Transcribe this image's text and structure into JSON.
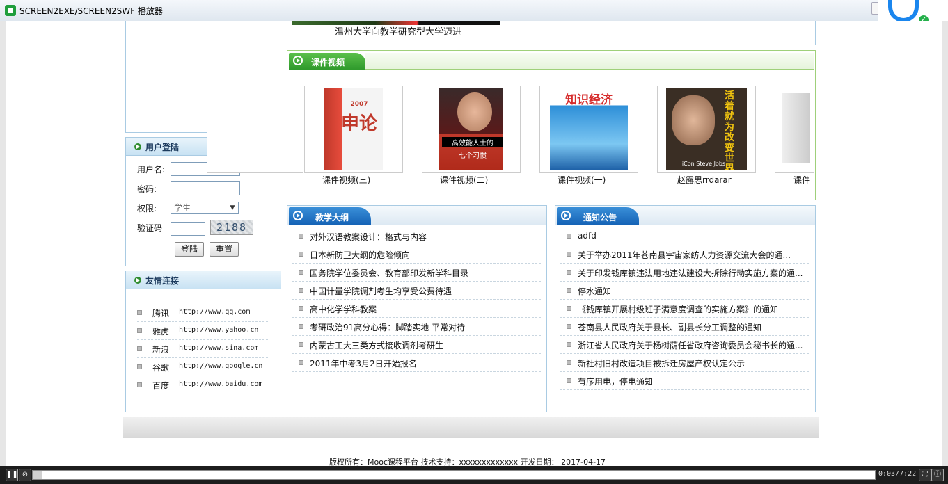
{
  "window": {
    "title": "SCREEN2EXE/SCREEN2SWF 播放器"
  },
  "news_caption": "温州大学向教学研究型大学迈进",
  "login": {
    "header": "用户登陆",
    "username_label": "用户名:",
    "password_label": "密码:",
    "role_label": "权限:",
    "role_value": "学生",
    "captcha_label": "验证码",
    "captcha_text": "2188",
    "login_button": "登陆",
    "reset_button": "重置"
  },
  "links": {
    "header": "友情连接",
    "items": [
      {
        "name": "腾讯",
        "url": "http://www.qq.com"
      },
      {
        "name": "雅虎",
        "url": "http://www.yahoo.cn"
      },
      {
        "name": "新浪",
        "url": "http://www.sina.com"
      },
      {
        "name": "谷歌",
        "url": "http://www.google.cn"
      },
      {
        "name": "百度",
        "url": "http://www.baidu.com"
      }
    ]
  },
  "videos": {
    "header": "课件视频",
    "items": [
      {
        "label": "课件视频(三)",
        "cover_text": "申论",
        "cover_sub": "2007"
      },
      {
        "label": "课件视频(二)",
        "cover_text": "高效能人士的",
        "cover_sub": "七个习惯"
      },
      {
        "label": "课件视频(一)",
        "cover_text": "知识经济",
        "cover_sub": ""
      },
      {
        "label": "赵露思rrdarar",
        "cover_text": "活着就为改变世界",
        "cover_sub": "iCon Steve Jobs"
      },
      {
        "label": "课件",
        "cover_text": "",
        "cover_sub": ""
      }
    ]
  },
  "syllabus": {
    "header": "教学大纲",
    "items": [
      "对外汉语教案设计：格式与内容",
      "日本新防卫大纲的危险倾向",
      "国务院学位委员会、教育部印发新学科目录",
      "中国计量学院调剂考生均享受公费待遇",
      "高中化学学科教案",
      "考研政治91高分心得：脚踏实地 平常对待",
      "内蒙古工大三类方式接收调剂考研生",
      "2011年中考3月2日开始报名"
    ]
  },
  "notices": {
    "header": "通知公告",
    "items": [
      "adfd",
      "关于举办2011年苍南县宇宙家纺人力资源交流大会的通...",
      "关于印发钱库镇违法用地违法建设大拆除行动实施方案的通...",
      "停水通知",
      "《钱库镇开展村级班子满意度调查的实施方案》的通知",
      "苍南县人民政府关于县长、副县长分工调整的通知",
      "浙江省人民政府关于杨树荫任省政府咨询委员会秘书长的通...",
      "新社村旧村改造项目被拆迁房屋产权认定公示",
      "有序用电，停电通知"
    ]
  },
  "footer": {
    "copyright": "版权所有：Mooc课程平台 技术支持：xxxxxxxxxxxxx 开发日期： 2017-04-17"
  },
  "player": {
    "time": "0:03/7:22",
    "progress": 0.007
  }
}
